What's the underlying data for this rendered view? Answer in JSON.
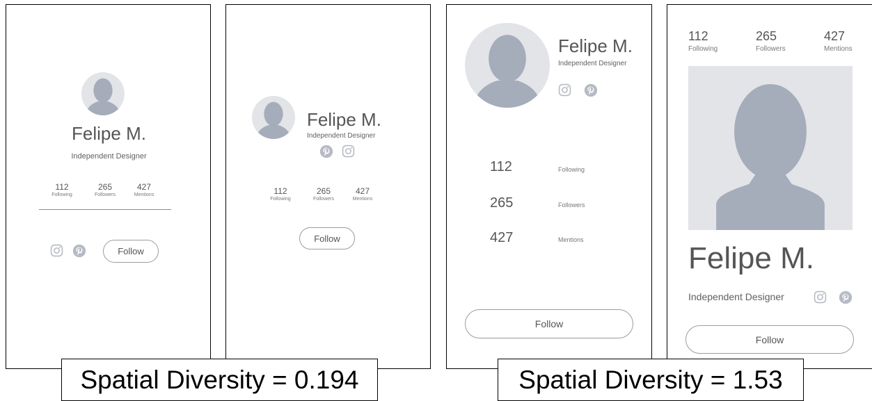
{
  "profile": {
    "name": "Felipe M.",
    "role": "Independent Designer",
    "follow_label": "Follow",
    "stats": [
      {
        "value": "112",
        "label": "Following"
      },
      {
        "value": "265",
        "label": "Followers"
      },
      {
        "value": "427",
        "label": "Mentions"
      }
    ]
  },
  "captions": {
    "low": "Spatial Diversity = 0.194",
    "high": "Spatial Diversity = 1.53"
  },
  "icons": [
    "instagram-icon",
    "pinterest-icon",
    "avatar-silhouette-icon"
  ],
  "colors": {
    "avatar_bg": "#e2e4e8",
    "avatar_fg": "#a5acba",
    "icon": "#b6bac4",
    "border": "#000000",
    "button_border": "#9a9ca2"
  }
}
